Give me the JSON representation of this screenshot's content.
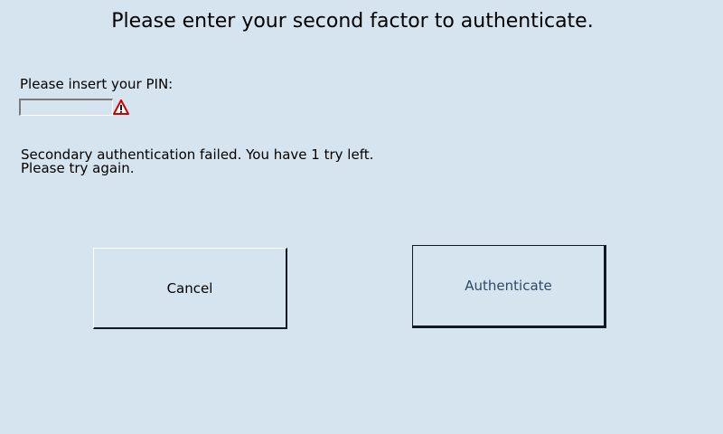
{
  "dialog": {
    "title": "Please enter your second factor to authenticate.",
    "pin_label": "Please insert your PIN:",
    "pin_value": "",
    "error_line1": "Secondary authentication failed. You have 1 try left.",
    "error_line2": "Please try again."
  },
  "buttons": {
    "cancel_label": "Cancel",
    "authenticate_label": "Authenticate"
  },
  "icons": {
    "error": "warning-icon"
  },
  "colors": {
    "background": "#d6e4f0",
    "warning_red": "#cc0000",
    "authenticate_text": "#2f4a6a"
  }
}
